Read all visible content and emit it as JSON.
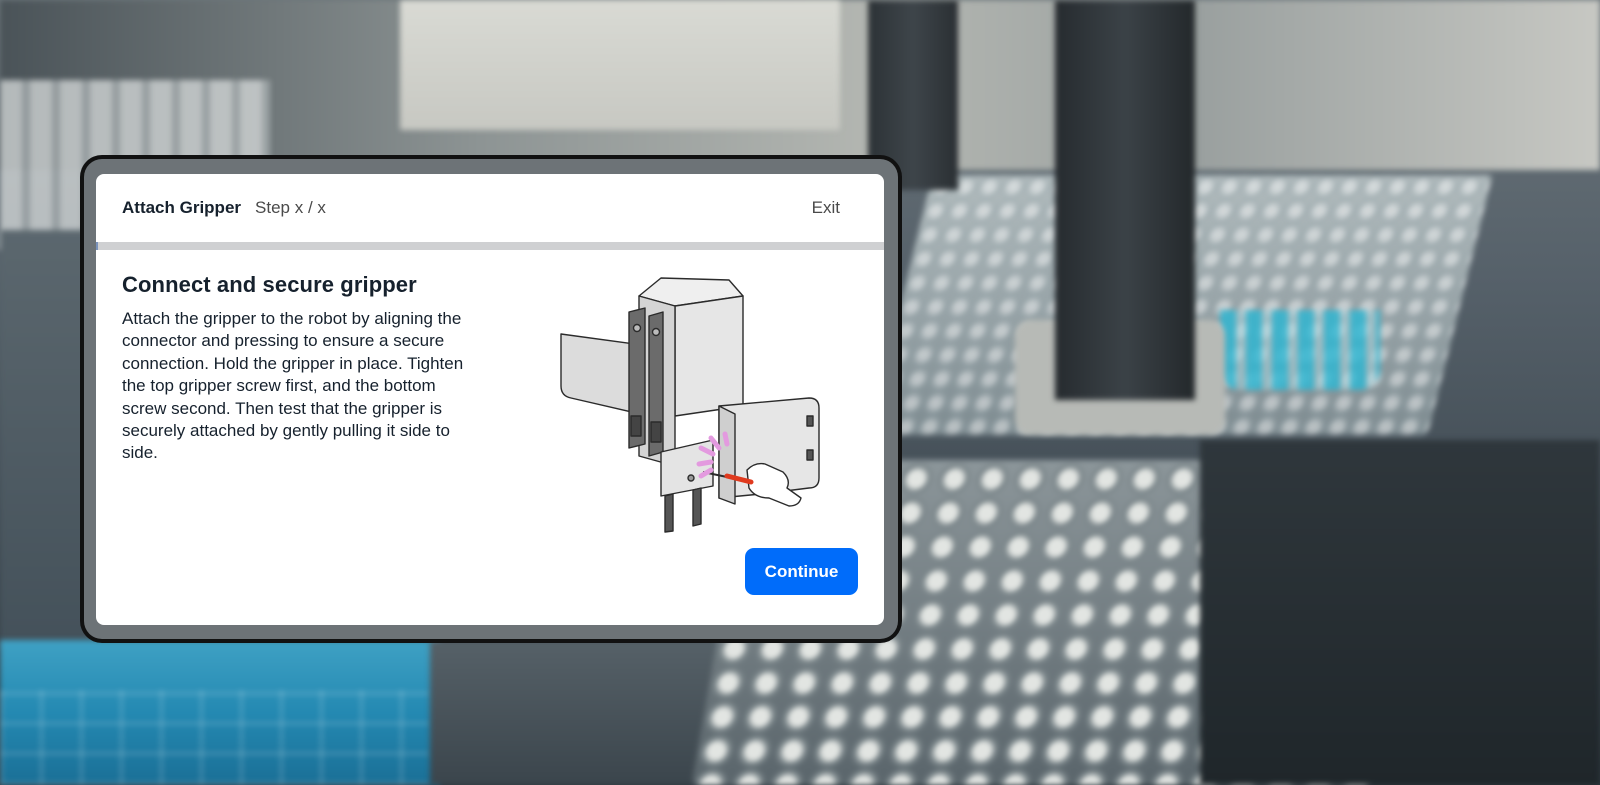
{
  "header": {
    "title": "Attach Gripper",
    "step": "Step x / x",
    "exit_label": "Exit"
  },
  "progress": {
    "fraction": 0.0
  },
  "content": {
    "title": "Connect and secure gripper",
    "body": "Attach the gripper to the robot by aligning the connector and pressing to ensure a secure connection. Hold the gripper in place. Tighten the top gripper screw first, and the bottom screw second. Then test that the gripper is securely attached by gently pulling it side to side."
  },
  "footer": {
    "continue_label": "Continue"
  },
  "colors": {
    "primary": "#006cfa",
    "text": "#16212d",
    "progress_track": "#cfd0d2",
    "progress_fill": "#7a92bb",
    "highlight": "#e39adf",
    "screwdriver": "#e03a1e"
  }
}
